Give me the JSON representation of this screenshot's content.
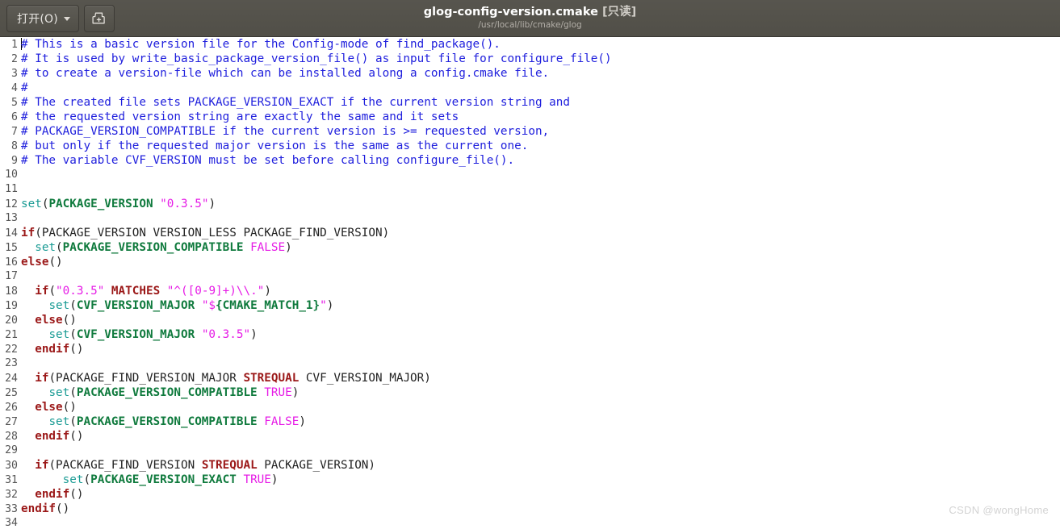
{
  "window": {
    "title": "glog-config-version.cmake",
    "readonly_tag": "[只读]",
    "subtitle": "/usr/local/lib/cmake/glog"
  },
  "toolbar": {
    "open_label": "打开(O)",
    "open_icon": "chevron-down-icon",
    "save_icon": "save-as-icon"
  },
  "editor": {
    "language": "cmake",
    "first_line": 1,
    "last_line": 34,
    "cursor_line": 1,
    "cursor_column": 1,
    "colors": {
      "comment": "#2020dd",
      "command": "#1a9b94",
      "keyword": "#9b1818",
      "variable": "#0f7a3d",
      "string": "#e61ce6",
      "plain": "#222222",
      "background": "#ffffff",
      "gutter_text": "#555555",
      "headerbar": "#55534c"
    },
    "lines": [
      {
        "n": 1,
        "tokens": [
          {
            "t": "# This is a basic version file for the Config-mode of find_package().",
            "c": "c-comment"
          }
        ]
      },
      {
        "n": 2,
        "tokens": [
          {
            "t": "# It is used by write_basic_package_version_file() as input file for configure_file()",
            "c": "c-comment"
          }
        ]
      },
      {
        "n": 3,
        "tokens": [
          {
            "t": "# to create a version-file which can be installed along a config.cmake file.",
            "c": "c-comment"
          }
        ]
      },
      {
        "n": 4,
        "tokens": [
          {
            "t": "#",
            "c": "c-comment"
          }
        ]
      },
      {
        "n": 5,
        "tokens": [
          {
            "t": "# The created file sets PACKAGE_VERSION_EXACT if the current version string and",
            "c": "c-comment"
          }
        ]
      },
      {
        "n": 6,
        "tokens": [
          {
            "t": "# the requested version string are exactly the same and it sets",
            "c": "c-comment"
          }
        ]
      },
      {
        "n": 7,
        "tokens": [
          {
            "t": "# PACKAGE_VERSION_COMPATIBLE if the current version is >= requested version,",
            "c": "c-comment"
          }
        ]
      },
      {
        "n": 8,
        "tokens": [
          {
            "t": "# but only if the requested major version is the same as the current one.",
            "c": "c-comment"
          }
        ]
      },
      {
        "n": 9,
        "tokens": [
          {
            "t": "# The variable CVF_VERSION must be set before calling configure_file().",
            "c": "c-comment"
          }
        ]
      },
      {
        "n": 10,
        "tokens": []
      },
      {
        "n": 11,
        "tokens": []
      },
      {
        "n": 12,
        "tokens": [
          {
            "t": "set",
            "c": "c-cmd"
          },
          {
            "t": "(",
            "c": "c-punc"
          },
          {
            "t": "PACKAGE_VERSION",
            "c": "c-var"
          },
          {
            "t": " ",
            "c": "c-plain"
          },
          {
            "t": "\"0.3.5\"",
            "c": "c-str"
          },
          {
            "t": ")",
            "c": "c-punc"
          }
        ]
      },
      {
        "n": 13,
        "tokens": []
      },
      {
        "n": 14,
        "tokens": [
          {
            "t": "if",
            "c": "c-kw"
          },
          {
            "t": "(PACKAGE_VERSION VERSION_LESS PACKAGE_FIND_VERSION)",
            "c": "c-plain"
          }
        ]
      },
      {
        "n": 15,
        "tokens": [
          {
            "t": "  ",
            "c": "c-plain"
          },
          {
            "t": "set",
            "c": "c-cmd"
          },
          {
            "t": "(",
            "c": "c-punc"
          },
          {
            "t": "PACKAGE_VERSION_COMPATIBLE",
            "c": "c-var"
          },
          {
            "t": " ",
            "c": "c-plain"
          },
          {
            "t": "FALSE",
            "c": "c-const"
          },
          {
            "t": ")",
            "c": "c-punc"
          }
        ]
      },
      {
        "n": 16,
        "tokens": [
          {
            "t": "else",
            "c": "c-kw"
          },
          {
            "t": "()",
            "c": "c-plain"
          }
        ]
      },
      {
        "n": 17,
        "tokens": []
      },
      {
        "n": 18,
        "tokens": [
          {
            "t": "  ",
            "c": "c-plain"
          },
          {
            "t": "if",
            "c": "c-kw"
          },
          {
            "t": "(",
            "c": "c-punc"
          },
          {
            "t": "\"0.3.5\"",
            "c": "c-str"
          },
          {
            "t": " ",
            "c": "c-plain"
          },
          {
            "t": "MATCHES",
            "c": "c-kw"
          },
          {
            "t": " ",
            "c": "c-plain"
          },
          {
            "t": "\"^([0-9]+)\\\\.\"",
            "c": "c-str"
          },
          {
            "t": ")",
            "c": "c-punc"
          }
        ]
      },
      {
        "n": 19,
        "tokens": [
          {
            "t": "    ",
            "c": "c-plain"
          },
          {
            "t": "set",
            "c": "c-cmd"
          },
          {
            "t": "(",
            "c": "c-punc"
          },
          {
            "t": "CVF_VERSION_MAJOR",
            "c": "c-var"
          },
          {
            "t": " ",
            "c": "c-plain"
          },
          {
            "t": "\"$",
            "c": "c-str"
          },
          {
            "t": "{CMAKE_MATCH_1}",
            "c": "c-var"
          },
          {
            "t": "\"",
            "c": "c-str"
          },
          {
            "t": ")",
            "c": "c-punc"
          }
        ]
      },
      {
        "n": 20,
        "tokens": [
          {
            "t": "  ",
            "c": "c-plain"
          },
          {
            "t": "else",
            "c": "c-kw"
          },
          {
            "t": "()",
            "c": "c-plain"
          }
        ]
      },
      {
        "n": 21,
        "tokens": [
          {
            "t": "    ",
            "c": "c-plain"
          },
          {
            "t": "set",
            "c": "c-cmd"
          },
          {
            "t": "(",
            "c": "c-punc"
          },
          {
            "t": "CVF_VERSION_MAJOR",
            "c": "c-var"
          },
          {
            "t": " ",
            "c": "c-plain"
          },
          {
            "t": "\"0.3.5\"",
            "c": "c-str"
          },
          {
            "t": ")",
            "c": "c-punc"
          }
        ]
      },
      {
        "n": 22,
        "tokens": [
          {
            "t": "  ",
            "c": "c-plain"
          },
          {
            "t": "endif",
            "c": "c-kw"
          },
          {
            "t": "()",
            "c": "c-plain"
          }
        ]
      },
      {
        "n": 23,
        "tokens": []
      },
      {
        "n": 24,
        "tokens": [
          {
            "t": "  ",
            "c": "c-plain"
          },
          {
            "t": "if",
            "c": "c-kw"
          },
          {
            "t": "(PACKAGE_FIND_VERSION_MAJOR ",
            "c": "c-plain"
          },
          {
            "t": "STREQUAL",
            "c": "c-kw"
          },
          {
            "t": " CVF_VERSION_MAJOR)",
            "c": "c-plain"
          }
        ]
      },
      {
        "n": 25,
        "tokens": [
          {
            "t": "    ",
            "c": "c-plain"
          },
          {
            "t": "set",
            "c": "c-cmd"
          },
          {
            "t": "(",
            "c": "c-punc"
          },
          {
            "t": "PACKAGE_VERSION_COMPATIBLE",
            "c": "c-var"
          },
          {
            "t": " ",
            "c": "c-plain"
          },
          {
            "t": "TRUE",
            "c": "c-const"
          },
          {
            "t": ")",
            "c": "c-punc"
          }
        ]
      },
      {
        "n": 26,
        "tokens": [
          {
            "t": "  ",
            "c": "c-plain"
          },
          {
            "t": "else",
            "c": "c-kw"
          },
          {
            "t": "()",
            "c": "c-plain"
          }
        ]
      },
      {
        "n": 27,
        "tokens": [
          {
            "t": "    ",
            "c": "c-plain"
          },
          {
            "t": "set",
            "c": "c-cmd"
          },
          {
            "t": "(",
            "c": "c-punc"
          },
          {
            "t": "PACKAGE_VERSION_COMPATIBLE",
            "c": "c-var"
          },
          {
            "t": " ",
            "c": "c-plain"
          },
          {
            "t": "FALSE",
            "c": "c-const"
          },
          {
            "t": ")",
            "c": "c-punc"
          }
        ]
      },
      {
        "n": 28,
        "tokens": [
          {
            "t": "  ",
            "c": "c-plain"
          },
          {
            "t": "endif",
            "c": "c-kw"
          },
          {
            "t": "()",
            "c": "c-plain"
          }
        ]
      },
      {
        "n": 29,
        "tokens": []
      },
      {
        "n": 30,
        "tokens": [
          {
            "t": "  ",
            "c": "c-plain"
          },
          {
            "t": "if",
            "c": "c-kw"
          },
          {
            "t": "(PACKAGE_FIND_VERSION ",
            "c": "c-plain"
          },
          {
            "t": "STREQUAL",
            "c": "c-kw"
          },
          {
            "t": " PACKAGE_VERSION)",
            "c": "c-plain"
          }
        ]
      },
      {
        "n": 31,
        "tokens": [
          {
            "t": "      ",
            "c": "c-plain"
          },
          {
            "t": "set",
            "c": "c-cmd"
          },
          {
            "t": "(",
            "c": "c-punc"
          },
          {
            "t": "PACKAGE_VERSION_EXACT",
            "c": "c-var"
          },
          {
            "t": " ",
            "c": "c-plain"
          },
          {
            "t": "TRUE",
            "c": "c-const"
          },
          {
            "t": ")",
            "c": "c-punc"
          }
        ]
      },
      {
        "n": 32,
        "tokens": [
          {
            "t": "  ",
            "c": "c-plain"
          },
          {
            "t": "endif",
            "c": "c-kw"
          },
          {
            "t": "()",
            "c": "c-plain"
          }
        ]
      },
      {
        "n": 33,
        "tokens": [
          {
            "t": "endif",
            "c": "c-kw"
          },
          {
            "t": "()",
            "c": "c-plain"
          }
        ]
      },
      {
        "n": 34,
        "tokens": []
      }
    ]
  },
  "watermark": {
    "text": "CSDN @wongHome"
  }
}
